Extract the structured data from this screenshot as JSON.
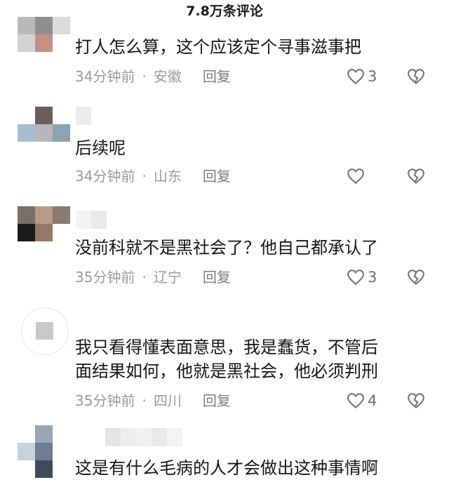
{
  "header": {
    "title": "7.8万条评论"
  },
  "comments": [
    {
      "text": [
        "打人怎么算，这个应该定个寻事滋事把"
      ],
      "time": "34分钟前",
      "location": "安徽",
      "reply": "回复",
      "likes": "3"
    },
    {
      "text": [
        "后续呢"
      ],
      "time": "34分钟前",
      "location": "山东",
      "reply": "回复",
      "likes": ""
    },
    {
      "text": [
        "没前科就不是黑社会了？他自己都承认了"
      ],
      "time": "35分钟前",
      "location": "辽宁",
      "reply": "回复",
      "likes": "3"
    },
    {
      "text": [
        "我只看得懂表面意思，我是蠢货，不管后",
        "面结果如何，他就是黑社会，他必须判刑"
      ],
      "time": "35分钟前",
      "location": "四川",
      "reply": "回复",
      "likes": "4"
    },
    {
      "text": [
        "这是有什么毛病的人才会做出这种事情啊"
      ]
    }
  ],
  "icons": {
    "like": "heart-outline-icon",
    "dislike": "broken-heart-icon"
  },
  "colors": {
    "text": "#151515",
    "meta": "#9a9a9a",
    "icon": "#6e6e6e"
  }
}
